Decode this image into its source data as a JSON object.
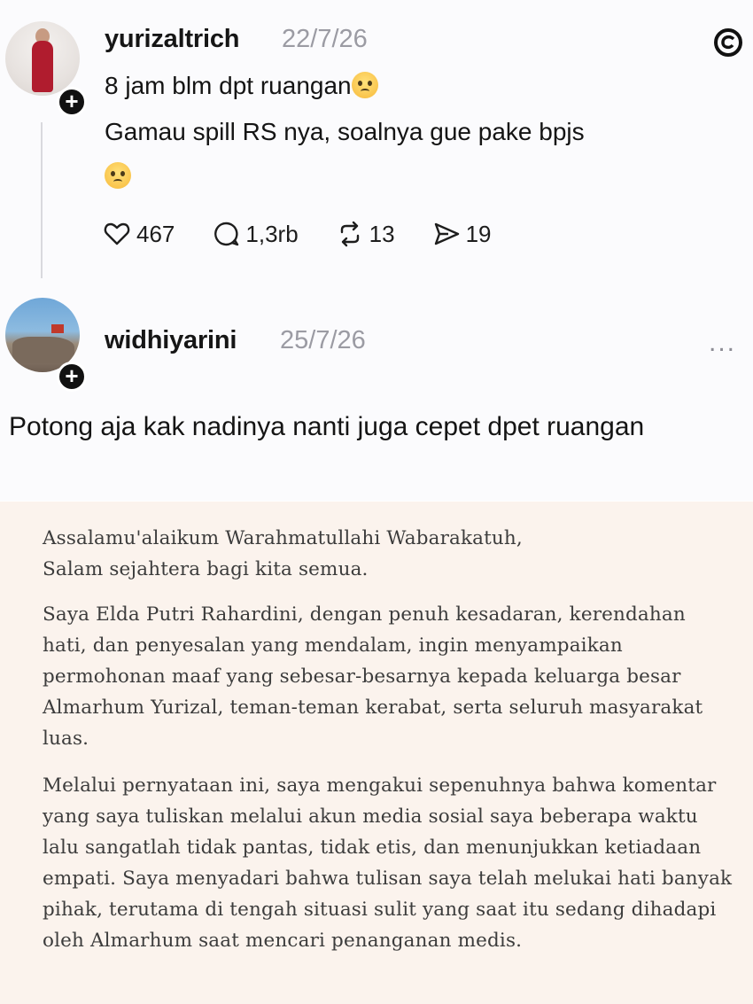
{
  "app": {
    "logo_icon": "threads-logo-icon"
  },
  "post": {
    "username": "yurizaltrich",
    "date": "22/7/26",
    "line1": "8 jam blm dpt ruangan",
    "line1_emoji": "crying-face-emoji",
    "line2": "Gamau spill RS nya, soalnya gue pake bpjs",
    "line3_emoji": "pleading-face-emoji",
    "actions": {
      "likes": "467",
      "comments": "1,3rb",
      "reposts": "13",
      "shares": "19"
    }
  },
  "reply": {
    "username": "widhiyarini",
    "date": "25/7/26",
    "more_label": "...",
    "text": "Potong aja kak nadinya nanti juga cepet dpet ruangan"
  },
  "statement": {
    "p1": "Assalamu'alaikum Warahmatullahi Wabarakatuh,\nSalam sejahtera bagi kita semua.",
    "p2": "Saya Elda Putri Rahardini, dengan penuh kesadaran, kerendahan hati, dan penyesalan yang mendalam, ingin menyampaikan permohonan maaf yang sebesar-besarnya kepada keluarga besar Almarhum Yurizal, teman-teman kerabat, serta seluruh masyarakat luas.",
    "p3": "Melalui pernyataan ini, saya mengakui sepenuhnya bahwa komentar yang saya tuliskan melalui akun media sosial saya beberapa waktu lalu sangatlah tidak pantas, tidak etis, dan menunjukkan ketiadaan empati. Saya menyadari bahwa tulisan saya telah melukai hati banyak pihak, terutama di tengah situasi sulit yang saat itu sedang dihadapi oleh Almarhum saat mencari penanganan medis."
  }
}
